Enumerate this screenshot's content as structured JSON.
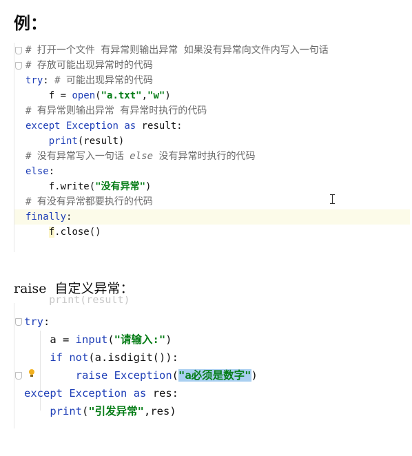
{
  "heading": "例：",
  "raise_heading": "raise  自定义异常：",
  "block1": {
    "lines": [
      {
        "text": "# 打开一个文件 有异常则输出异常 如果没有异常向文件内写入一句话"
      },
      {
        "text": "# 存放可能出现异常时的代码"
      },
      {
        "kw": "try",
        "p1": ": ",
        "cm": "# 可能出现异常的代码"
      },
      {
        "indent": "    ",
        "p1": "f = ",
        "fn": "open",
        "p2": "(",
        "s1": "\"a.txt\"",
        "p3": ",",
        "s2": "\"w\"",
        "p4": ")"
      },
      {
        "text": "# 有异常则输出异常 有异常时执行的代码"
      },
      {
        "kw": "except",
        "p1": " ",
        "fn": "Exception",
        "p2": " ",
        "kw2": "as",
        "p3": " result:"
      },
      {
        "indent": "    ",
        "fn": "print",
        "p1": "(result)"
      },
      {
        "c1": "# 没有异常写入一句话 ",
        "ci": "else",
        "c2": " 没有异常时执行的代码"
      },
      {
        "kw": "else",
        "p1": ":"
      },
      {
        "indent": "    ",
        "p1": "f.write(",
        "s1": "\"没有异常\"",
        "p2": ")"
      },
      {
        "text": "# 有没有异常都要执行的代码"
      },
      {
        "kw": "finally",
        "p1": ":"
      },
      {
        "indent": "    ",
        "f": "f",
        "p1": ".close()"
      }
    ]
  },
  "block2": {
    "ghost": "    print(result)",
    "lines": [
      {
        "kw": "try",
        "p1": ":"
      },
      {
        "indent": "    ",
        "p1": "a = ",
        "fn": "input",
        "p2": "(",
        "s1": "\"请输入:\"",
        "p3": ")"
      },
      {
        "indent": "    ",
        "kw": "if not",
        "p1": "(a.isdigit()):"
      },
      {
        "indent": "        ",
        "kw": "raise",
        "p1": " ",
        "fn": "Exception",
        "p2": "(",
        "s1": "\"a必须是数字\"",
        "p3": ")"
      },
      {
        "kw": "except",
        "p1": " ",
        "fn": "Exception",
        "p2": " ",
        "kw2": "as",
        "p3": " res:"
      },
      {
        "indent": "    ",
        "fn": "print",
        "p1": "(",
        "s1": "\"引发异常\"",
        "p2": ",res)"
      }
    ]
  }
}
